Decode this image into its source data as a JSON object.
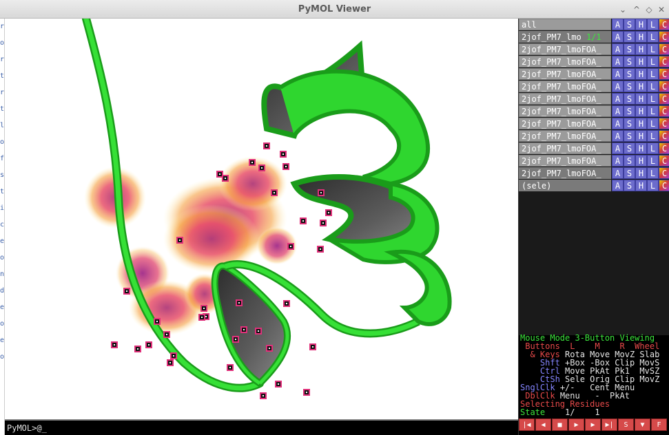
{
  "window": {
    "title": "PyMOL Viewer",
    "buttons": [
      "⌄",
      "^",
      "◇",
      "✕"
    ]
  },
  "left_strip": [
    "r",
    "o",
    "r",
    "t",
    "r",
    "t",
    "l",
    "o",
    "f",
    "s",
    "t",
    "i",
    "c",
    "e",
    "o",
    "n",
    "d",
    "e",
    "o",
    "e",
    "o"
  ],
  "command": {
    "prompt": "PyMOL>@_"
  },
  "objects": [
    {
      "name": "all",
      "state": "",
      "selected": false
    },
    {
      "name": "2jof_PM7_lmo",
      "state": "1/1",
      "selected": true
    },
    {
      "name": "2jof_PM7_lmoFOA_",
      "state": "",
      "selected": false
    },
    {
      "name": "2jof_PM7_lmoFOA_",
      "state": "",
      "selected": false
    },
    {
      "name": "2jof_PM7_lmoFOA_",
      "state": "",
      "selected": false
    },
    {
      "name": "2jof_PM7_lmoFOA_",
      "state": "",
      "selected": false
    },
    {
      "name": "2jof_PM7_lmoFOA_",
      "state": "",
      "selected": false
    },
    {
      "name": "2jof_PM7_lmoFOA_",
      "state": "",
      "selected": false
    },
    {
      "name": "2jof_PM7_lmoFOA_",
      "state": "",
      "selected": false
    },
    {
      "name": "2jof_PM7_lmoFOA_",
      "state": "",
      "selected": false
    },
    {
      "name": "2jof_PM7_lmoFOA_",
      "state": "",
      "selected": false
    },
    {
      "name": "2jof_PM7_lmoFOA_",
      "state": "",
      "selected": false
    },
    {
      "name": "2jof_PM7_lmoFOA_",
      "state": "",
      "selected": true
    },
    {
      "name": "(sele)",
      "state": "",
      "selected": true
    }
  ],
  "action_buttons": [
    "A",
    "S",
    "H",
    "L",
    "C"
  ],
  "mouse_help": {
    "mode": "Mouse Mode 3-Button Viewing",
    "header": " Buttons  L    M    R  Wheel",
    "rows": [
      {
        "key": "  & Keys",
        "vals": "Rota Move MovZ Slab"
      },
      {
        "key": "    Shft",
        "vals": "+Box -Box Clip MovS"
      },
      {
        "key": "    Ctrl",
        "vals": "Move PkAt Pk1  MvSZ"
      },
      {
        "key": "    CtSh",
        "vals": "Sele Orig Clip MovZ"
      },
      {
        "key": "SnglClk",
        "vals": "+/-   Cent Menu"
      },
      {
        "key": " DblClk",
        "vals": "Menu   -  PkAt"
      }
    ],
    "selecting": "Selecting Residues",
    "state_label": "State",
    "state_value": "    1/    1"
  },
  "playback": [
    "|◀",
    "◀",
    "■",
    "▶",
    "▶",
    "▶|",
    "S",
    "▼",
    "F"
  ],
  "colors": {
    "ribbon": "#2fd62f",
    "ribbon_dark": "#1a9c1a",
    "sheet_inner": "#505050",
    "atom_marker": "#e0307a"
  }
}
